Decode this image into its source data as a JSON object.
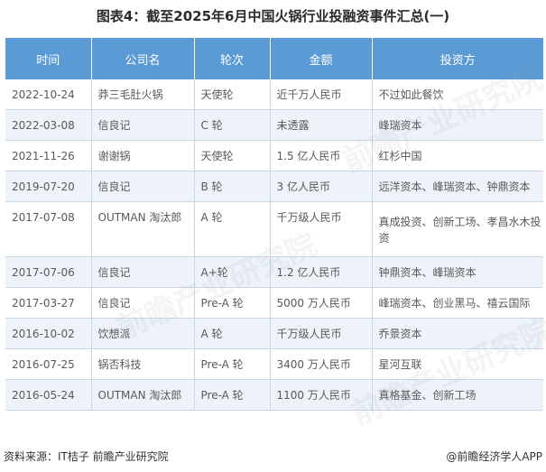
{
  "title": "图表4：截至2025年6月中国火锅行业投融资事件汇总(一)",
  "table": {
    "headers": [
      "时间",
      "公司名",
      "轮次",
      "金额",
      "投资方"
    ],
    "rows": [
      [
        "2022-10-24",
        "莽三毛肚火锅",
        "天使轮",
        "近千万人民币",
        "不过如此餐饮"
      ],
      [
        "2022-03-08",
        "信良记",
        "C 轮",
        "未透露",
        "峰瑞资本"
      ],
      [
        "2021-11-26",
        "谢谢锅",
        "天使轮",
        "1.5 亿人民币",
        "红杉中国"
      ],
      [
        "2019-07-20",
        "信良记",
        "B 轮",
        "3 亿人民币",
        "远洋资本、峰瑞资本、钟鼎资本"
      ],
      [
        "2017-07-08",
        "OUTMAN 淘汰郎",
        "A 轮",
        "千万级人民币",
        "真成投资、创新工场、孝昌水木投资"
      ],
      [
        "2017-07-06",
        "信良记",
        "A+轮",
        "1.2 亿人民币",
        "钟鼎资本、峰瑞资本"
      ],
      [
        "2017-03-27",
        "信良记",
        "Pre-A 轮",
        "5000 万人民币",
        "峰瑞资本、创业黑马、禧云国际"
      ],
      [
        "2016-10-02",
        "饮想派",
        "A 轮",
        "千万级人民币",
        "乔景资本"
      ],
      [
        "2016-07-25",
        "锅否科技",
        "Pre-A 轮",
        "3400 万人民币",
        "星河互联"
      ],
      [
        "2016-05-24",
        "OUTMAN 淘汰郎",
        "Pre-A 轮",
        "1100 万人民币",
        "真格基金、创新工场"
      ]
    ]
  },
  "footer": {
    "source": "资料来源：IT桔子 前瞻产业研究院",
    "brand": "@前瞻经济学人APP"
  },
  "watermark": "前瞻产业研究院"
}
